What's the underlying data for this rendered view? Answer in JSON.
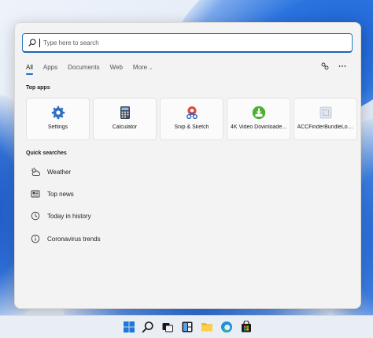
{
  "search": {
    "placeholder": "Type here to search"
  },
  "tabs": [
    {
      "label": "All"
    },
    {
      "label": "Apps"
    },
    {
      "label": "Documents"
    },
    {
      "label": "Web"
    },
    {
      "label": "More"
    }
  ],
  "toolbar": {
    "share_icon": "connected-devices-icon",
    "more_icon": "ellipsis-icon"
  },
  "top_apps": {
    "label": "Top apps",
    "items": [
      {
        "label": "Settings",
        "icon": "settings-gear-icon"
      },
      {
        "label": "Calculator",
        "icon": "calculator-icon"
      },
      {
        "label": "Snip & Sketch",
        "icon": "snip-sketch-icon"
      },
      {
        "label": "4K Video Downloade...",
        "icon": "video-downloader-icon"
      },
      {
        "label": "ACCFinderBundleLoa...",
        "icon": "app-placeholder-icon"
      }
    ]
  },
  "quick_searches": {
    "label": "Quick searches",
    "items": [
      {
        "label": "Weather",
        "icon": "weather-icon"
      },
      {
        "label": "Top news",
        "icon": "news-icon"
      },
      {
        "label": "Today in history",
        "icon": "clock-icon"
      },
      {
        "label": "Coronavirus trends",
        "icon": "info-icon"
      }
    ]
  },
  "taskbar": {
    "items": [
      "start-icon",
      "search-icon",
      "task-view-icon",
      "widgets-icon",
      "file-explorer-icon",
      "edge-icon",
      "store-icon"
    ]
  },
  "colors": {
    "accent": "#1f6fc4",
    "panel_bg": "#f3f3f3"
  }
}
